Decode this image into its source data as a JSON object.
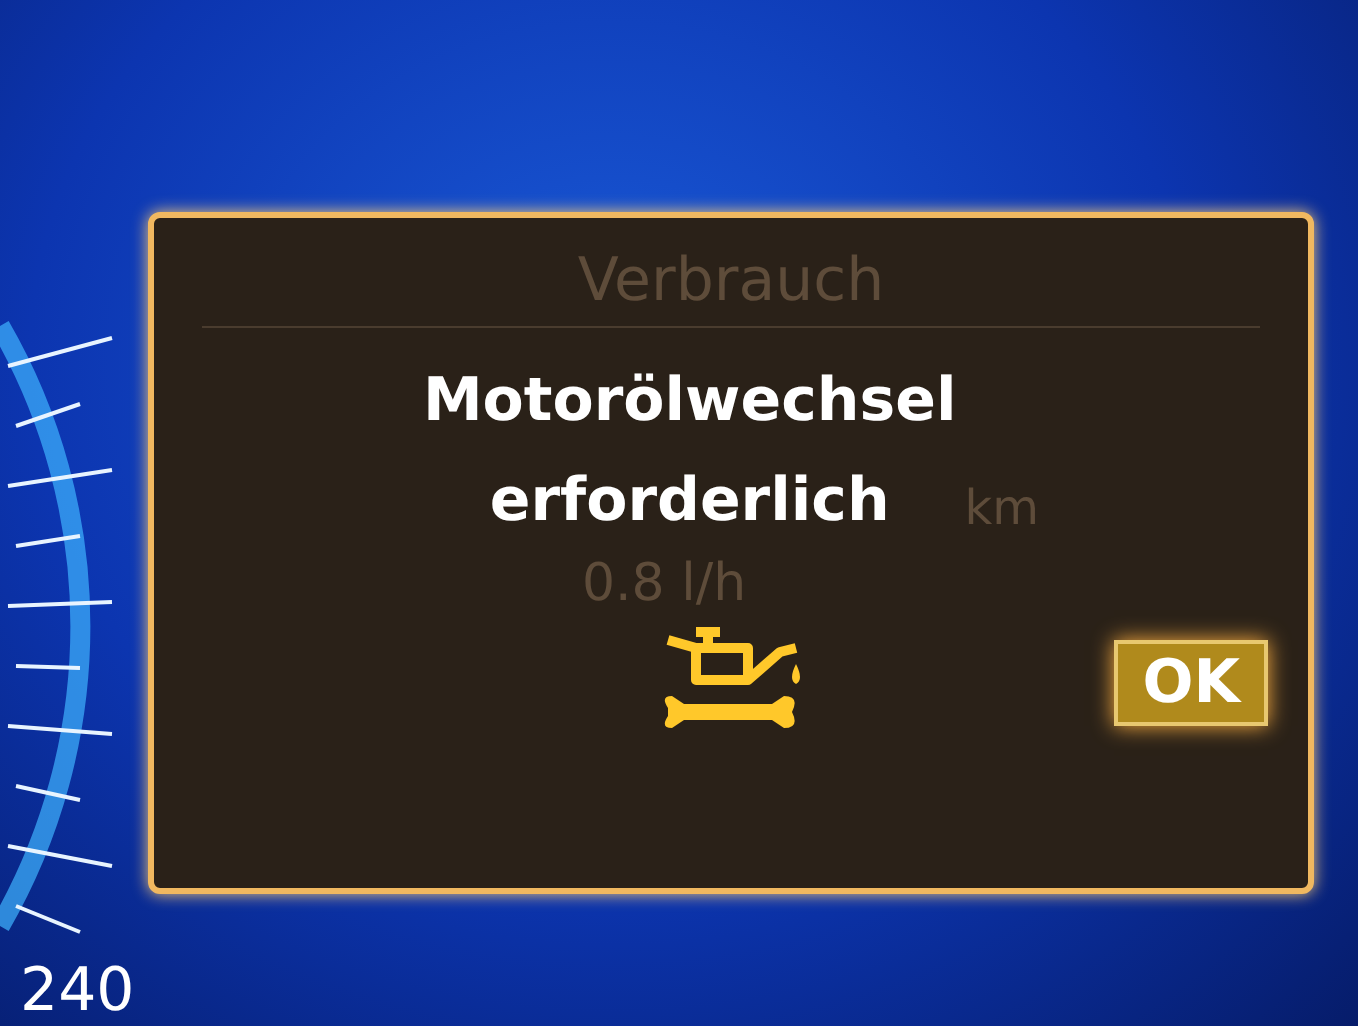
{
  "gauge": {
    "label": "240"
  },
  "background_panel": {
    "title": "Verbrauch",
    "readings": [
      "km",
      "0.8 l/h"
    ]
  },
  "dialog": {
    "message_lines": [
      "Motorölwechsel",
      "erforderlich"
    ],
    "button": "OK"
  }
}
